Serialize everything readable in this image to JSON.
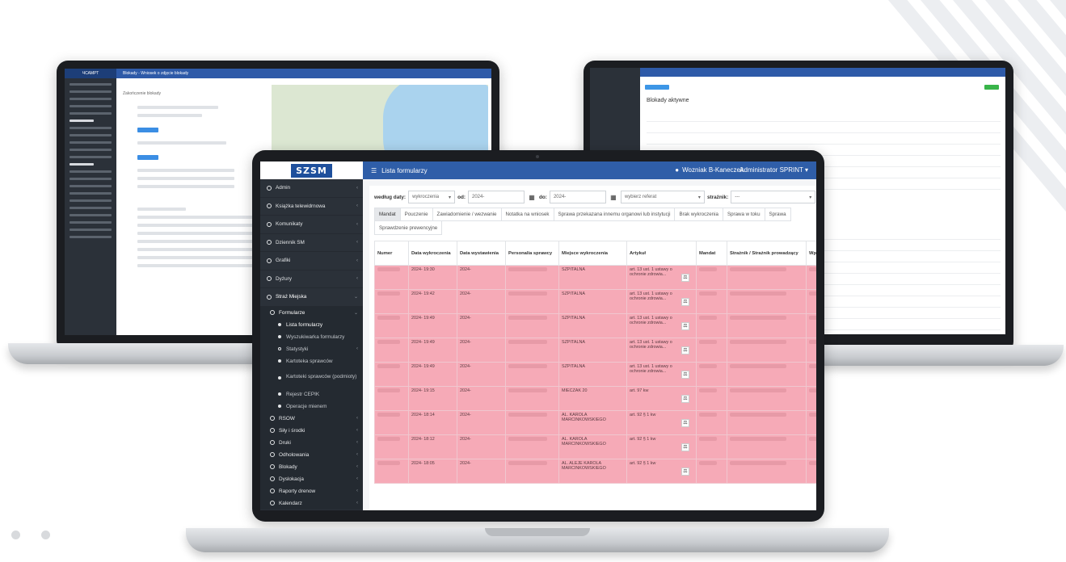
{
  "back_left": {
    "brand": "ЧСАМРТ",
    "title": "Blokady - Wniosek o zdjęcie blokady",
    "section": "Zakończenie blokady"
  },
  "back_right": {
    "title": "Blokady aktywne"
  },
  "main": {
    "logo": "SZSM",
    "topbar": {
      "menu_icon": "hamburger-icon",
      "title": "Lista formularzy",
      "user": "Wozniak B-Kaneczek",
      "admin": "Administrator SPRINT ▾"
    },
    "sidebar": [
      {
        "label": "Admin"
      },
      {
        "label": "Książka telewidrnowa"
      },
      {
        "label": "Komunikaty"
      },
      {
        "label": "Dziennik SM"
      },
      {
        "label": "Grafiki"
      },
      {
        "label": "Dyżury"
      },
      {
        "label": "Straż Miejska"
      }
    ],
    "sidebar_sub": {
      "label": "Formularze"
    },
    "sidebar_sub_items": [
      {
        "label": "Lista formularzy",
        "selected": true,
        "dot": "filled"
      },
      {
        "label": "Wyszukiwarka formularzy",
        "dot": "filled"
      },
      {
        "label": "Statystyki",
        "dot": "ring",
        "chev": "‹"
      },
      {
        "label": "Kartoteka sprawców",
        "dot": "filled"
      },
      {
        "label": "Kartoteki sprawców (podmioty)",
        "dot": "filled",
        "tall": true
      },
      {
        "label": "Rejestr CEPIK",
        "dot": "filled"
      },
      {
        "label": "Operacje mienem",
        "dot": "filled"
      }
    ],
    "sidebar_tail": [
      {
        "label": "RSOW"
      },
      {
        "label": "Siły i środki"
      },
      {
        "label": "Druki"
      },
      {
        "label": "Odholowania"
      },
      {
        "label": "Blokady"
      },
      {
        "label": "Dyslokacja"
      },
      {
        "label": "Raporty drenow"
      },
      {
        "label": "Kalendarz"
      }
    ],
    "filters": {
      "date_by_label": "według daty:",
      "date_by_value": "wykroczenia",
      "from_label": "od:",
      "from_value": "2024-",
      "to_label": "do:",
      "to_value": "2024-",
      "referat_value": "wybierz referat",
      "guard_label": "strażnik:",
      "guard_value": "---"
    },
    "tabs": [
      {
        "label": "Mandat",
        "active": true
      },
      {
        "label": "Pouczenie"
      },
      {
        "label": "Zawiadomienie / wezwanie"
      },
      {
        "label": "Notatka na wniosek"
      },
      {
        "label": "Sprawa przekazana innemu organowi lub instytucji"
      },
      {
        "label": "Brak wykroczenia"
      },
      {
        "label": "Sprawa w toku"
      },
      {
        "label": "Sprawa"
      }
    ],
    "tabs_row2": [
      {
        "label": "Sprawdzenie prewencyjne"
      }
    ],
    "table": {
      "headers": [
        "Numer",
        "Data wykroczenia",
        "Data wystawienia",
        "Personalia sprawcy",
        "Miejsce wykroczenia",
        "Artykuł",
        "Mandat",
        "Strażnik / Strażnik prowadzący",
        "Wp"
      ],
      "rows": [
        {
          "time": "2024- 19:30",
          "issued": "2024-",
          "place": "SZPITALNA",
          "article": "art. 13 ust. 1 ustawy o ochronie zdrowia..."
        },
        {
          "time": "2024- 19:42",
          "issued": "2024-",
          "place": "SZPITALNA",
          "article": "art. 13 ust. 1 ustawy o ochronie zdrowia..."
        },
        {
          "time": "2024- 19:49",
          "issued": "2024-",
          "place": "SZPITALNA",
          "article": "art. 13 ust. 1 ustawy o ochronie zdrowia..."
        },
        {
          "time": "2024- 19:49",
          "issued": "2024-",
          "place": "SZPITALNA",
          "article": "art. 13 ust. 1 ustawy o ochronie zdrowia..."
        },
        {
          "time": "2024- 19:49",
          "issued": "2024-",
          "place": "SZPITALNA",
          "article": "art. 13 ust. 1 ustawy o ochronie zdrowia..."
        },
        {
          "time": "2024- 19:15",
          "issued": "2024-",
          "place": "MIECZAK 20",
          "article": "art. 97 kw"
        },
        {
          "time": "2024- 18:14",
          "issued": "2024-",
          "place": "AL. KAROLA MARCINKOWSKIEGO",
          "article": "art. 92 § 1 kw"
        },
        {
          "time": "2024- 18:12",
          "issued": "2024-",
          "place": "AL. KAROLA MARCINKOWSKIEGO",
          "article": "art. 92 § 1 kw"
        },
        {
          "time": "2024- 18:05",
          "issued": "2024-",
          "place": "AL. ALEJE KAROLA MARCINKOWSKIEGO",
          "article": "art. 92 § 1 kw"
        }
      ]
    }
  }
}
